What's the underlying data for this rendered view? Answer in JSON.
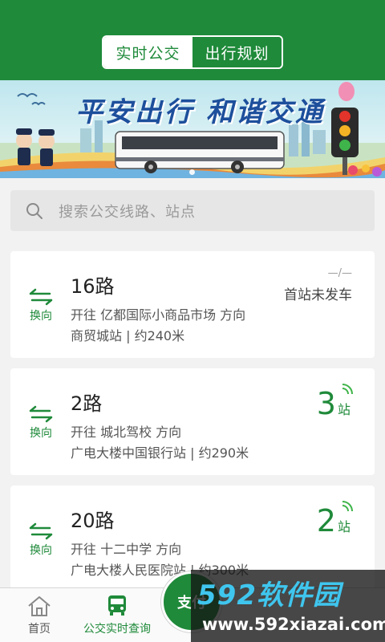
{
  "header": {
    "tabs": [
      {
        "label": "实时公交",
        "active": true
      },
      {
        "label": "出行规划",
        "active": false
      }
    ],
    "accent_color": "#1f8a3a"
  },
  "banner": {
    "slogan": "平安出行 和谐交通",
    "page_indicator": {
      "current": 1,
      "total": 1
    }
  },
  "search": {
    "placeholder": "搜索公交线路、站点"
  },
  "routes": [
    {
      "name": "16路",
      "swap_label": "换向",
      "direction": "开往 亿都国际小商品市场 方向",
      "stop_info": "商贸城站 | 约240米",
      "status_dash": "—/—",
      "status_text": "首站未发车"
    },
    {
      "name": "2路",
      "swap_label": "换向",
      "direction": "开往 城北驾校 方向",
      "stop_info": "广电大楼中国银行站 | 约290米",
      "stops_away": "3",
      "stops_unit": "站"
    },
    {
      "name": "20路",
      "swap_label": "换向",
      "direction": "开往 十二中学 方向",
      "stop_info": "广电大楼人民医院站 | 约300米",
      "stops_away": "2",
      "stops_unit": "站"
    }
  ],
  "bottom_nav": {
    "home_label": "首页",
    "bus_label": "公交实时查询",
    "pay_label": "支付"
  },
  "watermark": {
    "brand": "592软件园",
    "url": "www.592xiazai.com"
  }
}
